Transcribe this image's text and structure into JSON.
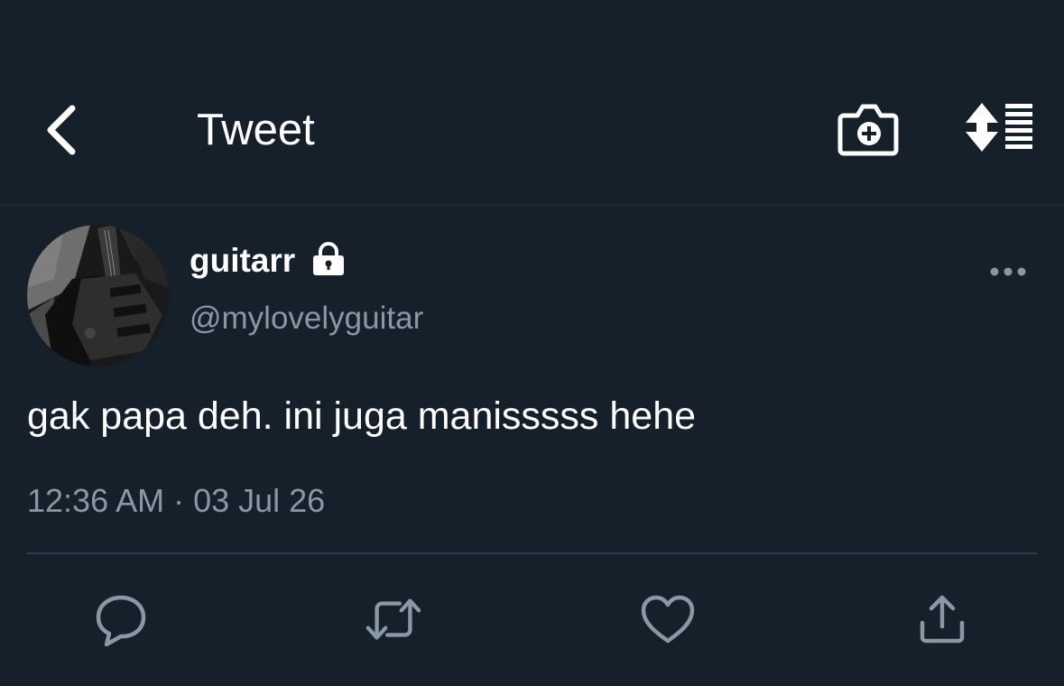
{
  "header": {
    "title": "Tweet",
    "icons": {
      "back": "chevron-left-icon",
      "camera": "camera-plus-icon",
      "sort": "sort-toggle-icon"
    }
  },
  "tweet": {
    "author": {
      "display_name": "guitarr",
      "handle": "@mylovelyguitar",
      "protected": true,
      "avatar": "guitar photo"
    },
    "text": "gak papa deh. ini juga manisssss hehe",
    "timestamp": "12:36 AM · 03 Jul 26"
  },
  "actions": [
    "reply",
    "retweet",
    "like",
    "share"
  ],
  "colors": {
    "background": "#15202b",
    "text_primary": "#ffffff",
    "text_secondary": "#8899a6",
    "divider": "#2f3d4a"
  }
}
